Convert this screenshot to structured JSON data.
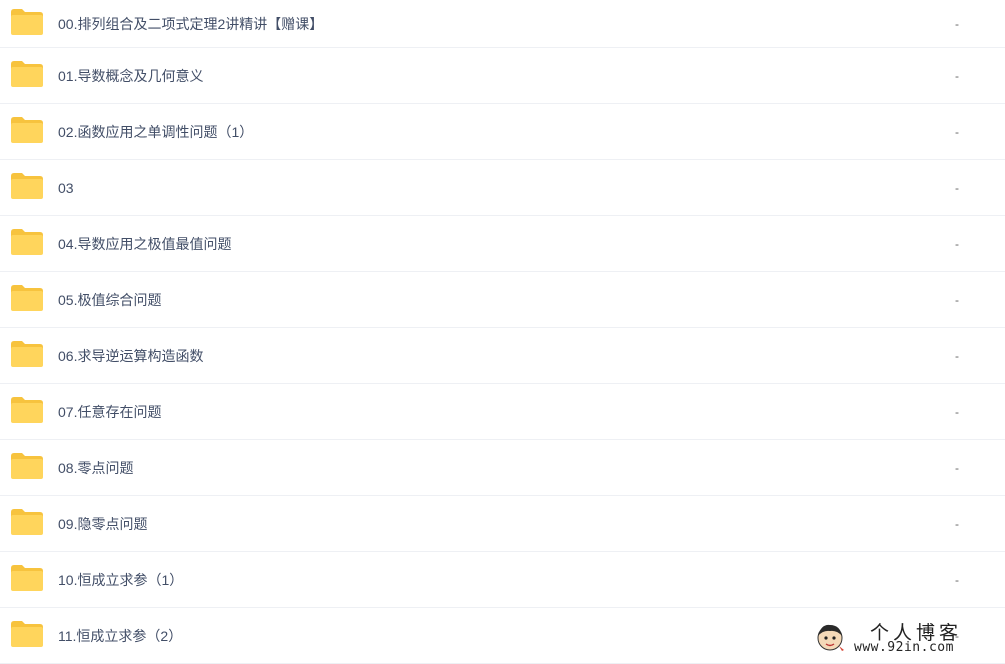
{
  "files": [
    {
      "name": "00.排列组合及二项式定理2讲精讲【赠课】",
      "size": "-",
      "icon": "folder-icon"
    },
    {
      "name": "01.导数概念及几何意义",
      "size": "-",
      "icon": "folder-icon"
    },
    {
      "name": "02.函数应用之单调性问题（1）",
      "size": "-",
      "icon": "folder-icon"
    },
    {
      "name": "03",
      "size": "-",
      "icon": "folder-icon"
    },
    {
      "name": "04.导数应用之极值最值问题",
      "size": "-",
      "icon": "folder-icon"
    },
    {
      "name": "05.极值综合问题",
      "size": "-",
      "icon": "folder-icon"
    },
    {
      "name": "06.求导逆运算构造函数",
      "size": "-",
      "icon": "folder-icon"
    },
    {
      "name": "07.任意存在问题",
      "size": "-",
      "icon": "folder-icon"
    },
    {
      "name": "08.零点问题",
      "size": "-",
      "icon": "folder-icon"
    },
    {
      "name": "09.隐零点问题",
      "size": "-",
      "icon": "folder-icon"
    },
    {
      "name": "10.恒成立求参（1）",
      "size": "-",
      "icon": "folder-icon"
    },
    {
      "name": "11.恒成立求参（2）",
      "size": "-",
      "icon": "folder-icon"
    }
  ],
  "watermark": {
    "title": "个人博客",
    "url": "www.92in.com"
  },
  "colors": {
    "folder": "#ffd55c",
    "folder_tab": "#f7c33e",
    "text": "#424e67",
    "divider": "#eef0f4"
  }
}
